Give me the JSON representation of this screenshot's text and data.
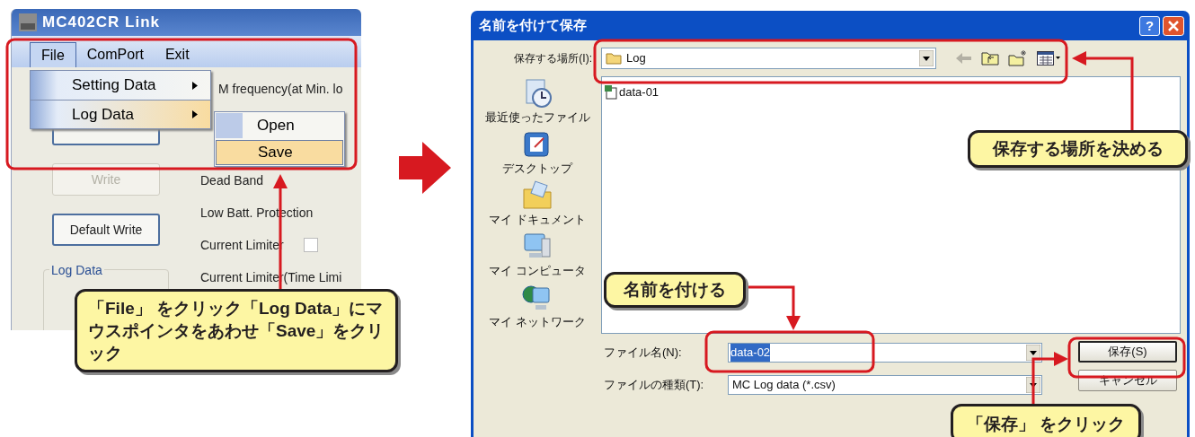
{
  "app_window": {
    "title": "MC402CR Link",
    "menu": [
      {
        "label": "File",
        "selected": true
      },
      {
        "label": "ComPort",
        "selected": false
      },
      {
        "label": "Exit",
        "selected": false
      }
    ],
    "file_menu": [
      {
        "label": "Setting Data",
        "selected": false
      },
      {
        "label": "Log Data",
        "selected": true
      }
    ],
    "log_submenu": [
      {
        "label": "Open",
        "selected": false
      },
      {
        "label": "Save",
        "selected": true
      }
    ],
    "buttons": [
      {
        "label": "Write",
        "disabled": true
      },
      {
        "label": "Default Write",
        "disabled": false
      }
    ],
    "group_title": "Log Data",
    "settings": [
      {
        "label": "M frequency(at Min. lo"
      },
      {
        "label": "Dead Band"
      },
      {
        "label": "Low Batt. Protection"
      },
      {
        "label": "Current Limiter",
        "checked": false
      },
      {
        "label": "Current Limiter(Time Limi"
      }
    ]
  },
  "save_dialog": {
    "title": "名前を付けて保存",
    "help": "?",
    "location_label": "保存する場所(I):",
    "location": "Log",
    "places": [
      {
        "kind": "recent",
        "label": "最近使ったファイル"
      },
      {
        "kind": "desktop",
        "label": "デスクトップ"
      },
      {
        "kind": "documents",
        "label": "マイ ドキュメント"
      },
      {
        "kind": "computer",
        "label": "マイ コンピュータ"
      },
      {
        "kind": "network",
        "label": "マイ ネットワーク"
      }
    ],
    "files": [
      {
        "name": "data-01",
        "selected": false
      }
    ],
    "filename_label": "ファイル名(N):",
    "filename": "data-02",
    "filename_selected": true,
    "filetype_label": "ファイルの種類(T):",
    "filetype": "MC Log data (*.csv)",
    "buttons": [
      {
        "label": "保存(S)",
        "default": true
      },
      {
        "label": "キャンセル",
        "default": false
      }
    ]
  },
  "callouts": [
    {
      "text": "「File」 をクリック「Log Data」にマウスポインタをあわせ「Save」をクリック"
    },
    {
      "text": "保存する場所を決める"
    },
    {
      "text": "名前を付ける"
    },
    {
      "text": "「保存」 をクリック"
    }
  ]
}
